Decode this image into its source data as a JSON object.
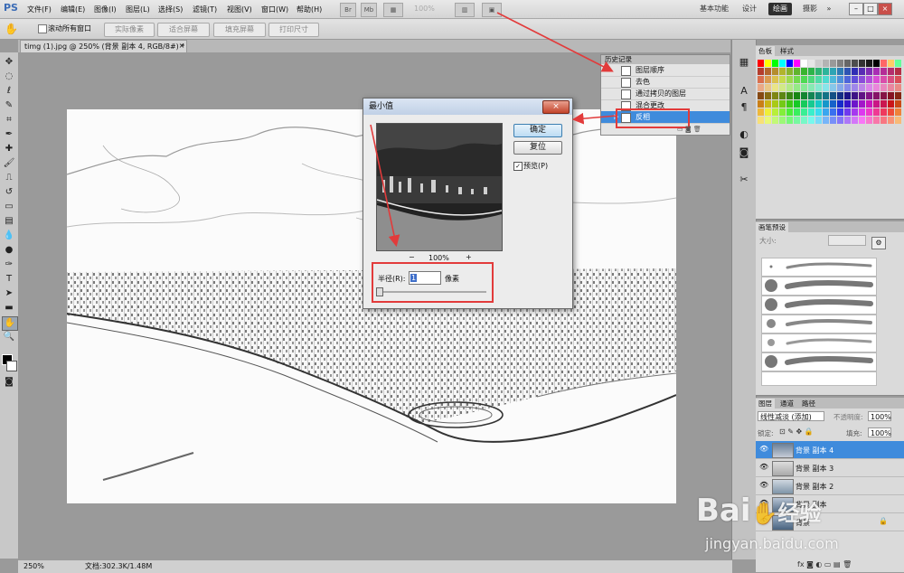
{
  "app": {
    "logo": "PS"
  },
  "menu": [
    "文件(F)",
    "编辑(E)",
    "图像(I)",
    "图层(L)",
    "选择(S)",
    "滤镜(T)",
    "视图(V)",
    "窗口(W)",
    "帮助(H)"
  ],
  "top_icons": {
    "br": "Br",
    "mb": "Mb",
    "zoom": "100%"
  },
  "workspaces": [
    "基本功能",
    "设计",
    "绘画",
    "摄影"
  ],
  "workspace_more": "»",
  "window_controls": [
    "–",
    "□",
    "×"
  ],
  "options": {
    "scroll_all_label": "滚动所有窗口",
    "actual_pixels": "实际像素",
    "fit_screen": "适合屏幕",
    "fill_screen": "填充屏幕",
    "print_size": "打印尺寸"
  },
  "document": {
    "tab_title": "timg (1).jpg @ 250% (背景 副本 4, RGB/8#) *",
    "close": "×"
  },
  "statusbar": {
    "zoom": "250%",
    "doc_size": "文档:302.3K/1.48M"
  },
  "dialog": {
    "title": "最小值",
    "close": "×",
    "ok": "确定",
    "reset": "复位",
    "preview_label": "预览(P)",
    "preview_checked": "✓",
    "zoom_minus": "−",
    "zoom_level": "100%",
    "zoom_plus": "+",
    "radius_label": "半径(R):",
    "radius_value": "1",
    "radius_unit": "像素"
  },
  "history": {
    "title": "历史记录",
    "items": [
      "图层顺序",
      "去色",
      "通过拷贝的图层",
      "混合更改",
      "反相"
    ],
    "selected_index": 4
  },
  "swatches": {
    "tabs": [
      "色板",
      "样式"
    ]
  },
  "brush_presets": {
    "tabs": [
      "画笔预设"
    ],
    "size_label": "大小:"
  },
  "layers": {
    "tabs": [
      "图层",
      "通道",
      "路径"
    ],
    "blend_mode": "线性减淡 (添加)",
    "opacity_label": "不透明度:",
    "opacity": "100%",
    "lock_label": "锁定:",
    "fill_label": "填充:",
    "fill": "100%",
    "items": [
      "背景 副本 4",
      "背景 副本 3",
      "背景 副本 2",
      "背景 副本",
      "背景"
    ],
    "selected_index": 0,
    "bottom_icons": "fx"
  },
  "watermark": {
    "logo": "Bai",
    "logo_suffix": "经验",
    "url": "jingyan.baidu.com"
  },
  "colors": {
    "accent": "#3f8bdc",
    "red_highlight": "#e23b3b"
  }
}
